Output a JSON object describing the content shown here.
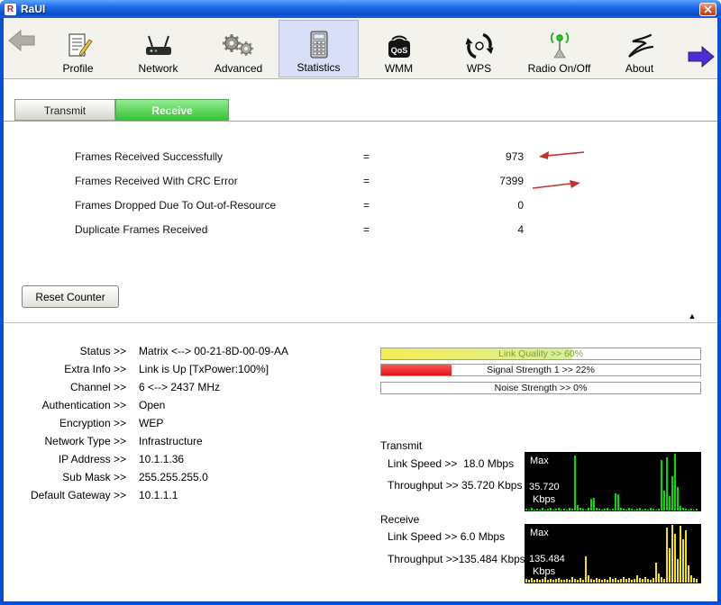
{
  "window": {
    "title": "RaUI",
    "app_icon_letter": "R"
  },
  "colors": {
    "titlebar_blue": "#0B50D2",
    "active_tab_green": "#35C435",
    "statistics_highlight": "#D9DFF6",
    "annotation_red": "#C23030",
    "signal_red": "#E11212",
    "link_quality_yellow": "#F2ED52",
    "tx_bar_green": "#00DC00",
    "rx_bar_yellow": "#F2E40A"
  },
  "toolbar": {
    "items": [
      {
        "label": "Profile"
      },
      {
        "label": "Network"
      },
      {
        "label": "Advanced"
      },
      {
        "label": "Statistics",
        "active": true
      },
      {
        "label": "WMM",
        "icon_text": "QoS"
      },
      {
        "label": "WPS"
      },
      {
        "label": "Radio On/Off"
      },
      {
        "label": "About"
      }
    ]
  },
  "tabs": {
    "transmit": "Transmit",
    "receive": "Receive"
  },
  "statistics": {
    "rows": [
      {
        "label": "Frames Received Successfully",
        "eq": "=",
        "value": "973"
      },
      {
        "label": "Frames Received With CRC Error",
        "eq": "=",
        "value": "7399"
      },
      {
        "label": "Frames Dropped Due To Out-of-Resource",
        "eq": "=",
        "value": "0"
      },
      {
        "label": "Duplicate Frames Received",
        "eq": "=",
        "value": "4"
      }
    ],
    "reset_button": "Reset Counter"
  },
  "collapse_label": "▲",
  "link_status": {
    "rows": [
      {
        "label": "Status >>",
        "value": "Matrix <--> 00-21-8D-00-09-AA"
      },
      {
        "label": "Extra Info >>",
        "value": "Link is Up [TxPower:100%]"
      },
      {
        "label": "Channel >>",
        "value": "6 <--> 2437 MHz"
      },
      {
        "label": "Authentication >>",
        "value": "Open"
      },
      {
        "label": "Encryption >>",
        "value": "WEP"
      },
      {
        "label": "Network Type >>",
        "value": "Infrastructure"
      },
      {
        "label": "IP Address >>",
        "value": "10.1.1.36"
      },
      {
        "label": "Sub Mask >>",
        "value": "255.255.255.0"
      },
      {
        "label": "Default Gateway >>",
        "value": "10.1.1.1"
      }
    ]
  },
  "quality": {
    "link_quality": {
      "text": "Link Quality >> 60%",
      "percent": 60
    },
    "signal_strength": {
      "text": "Signal Strength 1 >> 22%",
      "percent": 22
    },
    "noise_strength": {
      "text": "Noise Strength >> 0%",
      "percent": 0
    }
  },
  "transmit": {
    "section_label": "Transmit",
    "link_speed": "Link Speed >>  18.0 Mbps",
    "throughput": "Throughput >> 35.720 Kbps",
    "chart": {
      "max_label": "Max",
      "value": "35.720",
      "unit": "Kbps",
      "bar_color": "#00DC00",
      "bars": [
        3,
        2,
        4,
        2,
        3,
        2,
        5,
        2,
        3,
        4,
        2,
        3,
        5,
        2,
        3,
        2,
        4,
        3,
        95,
        10,
        4,
        3,
        2,
        4,
        20,
        22,
        4,
        3,
        2,
        3,
        4,
        2,
        3,
        30,
        28,
        4,
        3,
        2,
        4,
        3,
        2,
        3,
        4,
        2,
        3,
        2,
        4,
        3,
        2,
        3,
        88,
        35,
        92,
        25,
        60,
        98,
        40,
        8,
        4,
        3,
        2,
        3,
        2,
        3
      ]
    }
  },
  "receive": {
    "section_label": "Receive",
    "link_speed": "Link Speed >> 6.0 Mbps",
    "throughput": "Throughput >>135.484 Kbps",
    "chart": {
      "max_label": "Max",
      "value": "135.484",
      "unit": "Kbps",
      "bar_color": "#F2E40A",
      "bars": [
        6,
        4,
        8,
        5,
        7,
        4,
        6,
        9,
        5,
        7,
        4,
        6,
        8,
        5,
        4,
        7,
        5,
        9,
        6,
        4,
        8,
        5,
        45,
        12,
        7,
        5,
        8,
        6,
        4,
        7,
        5,
        9,
        6,
        8,
        5,
        7,
        10,
        6,
        8,
        5,
        7,
        12,
        8,
        6,
        9,
        7,
        5,
        8,
        35,
        15,
        9,
        7,
        95,
        60,
        100,
        85,
        40,
        98,
        75,
        90,
        30,
        12,
        8,
        6
      ]
    }
  }
}
